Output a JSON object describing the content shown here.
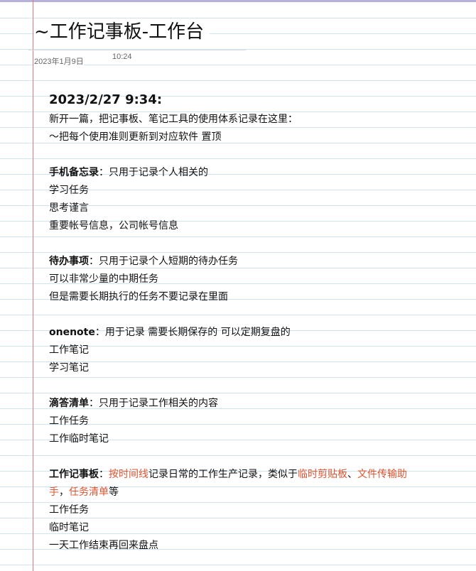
{
  "page": {
    "title": "~工作记事板-工作台",
    "date": "2023年1月9日",
    "time": "10:24"
  },
  "note": {
    "heading": "2023/2/27 9:34:",
    "intro": [
      "新开一篇，把记事板、笔记工具的使用体系记录在这里：",
      "～把每个使用准则更新到对应软件 置顶"
    ],
    "sections": [
      {
        "title": "手机备忘录",
        "desc": "：只用于记录个人相关的",
        "items": [
          "学习任务",
          "思考谨言",
          "重要帐号信息，公司帐号信息"
        ]
      },
      {
        "title": "待办事项",
        "desc": "：只用于记录个人短期的待办任务",
        "items": [
          "可以非常少量的中期任务",
          "但是需要长期执行的任务不要记录在里面"
        ]
      },
      {
        "title": "onenote",
        "desc": "：用于记录 需要长期保存的 可以定期复盘的",
        "items": [
          "工作笔记",
          "学习笔记"
        ]
      },
      {
        "title": "滴答清单",
        "desc": "：只用于记录工作相关的内容",
        "items": [
          "工作任务",
          "工作临时笔记"
        ]
      }
    ],
    "workboard": {
      "title": "工作记事板",
      "colon": "：",
      "hl1": "按时间线",
      "text1": "记录日常的工作生产记录，类似于",
      "hl2": "临时剪贴板",
      "sep1": "、",
      "hl3": "文件传输助",
      "hl3b": "手",
      "sep2": "，",
      "hl4": "任务清单",
      "text2": "等",
      "items": [
        "工作任务",
        "临时笔记",
        "一天工作结束再回来盘点"
      ]
    }
  },
  "colors": {
    "highlight": "#e0532f",
    "margin_line": "#e07a7a",
    "rule_line": "#cfe4ee",
    "top_bar": "#b9b0dc"
  }
}
